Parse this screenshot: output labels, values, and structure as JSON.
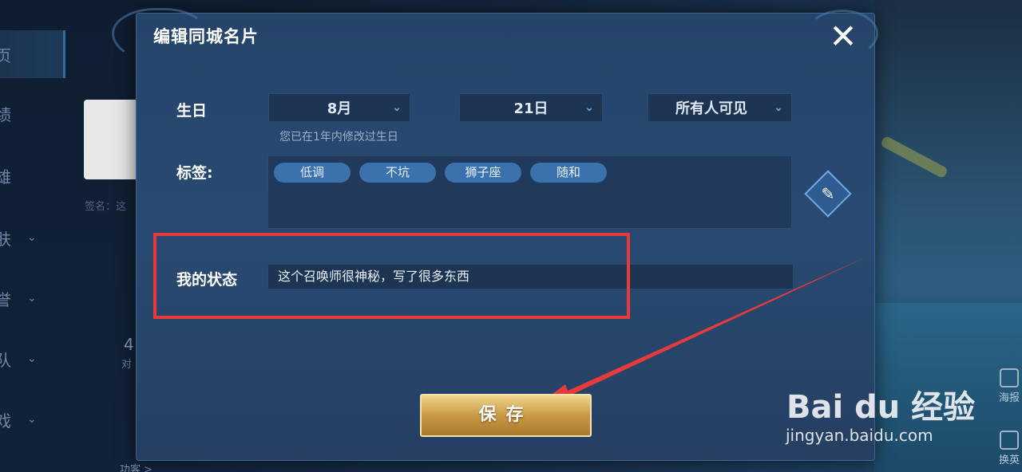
{
  "background": {
    "nav_items": [
      "页",
      "绩",
      "雄",
      "肤",
      "誉",
      "队",
      "戏"
    ],
    "sign_text": "签名：这",
    "stat_number": "4",
    "stat_label": "对",
    "bottom_text": "功客 >",
    "side_buttons": [
      "海报",
      "换英"
    ]
  },
  "dialog": {
    "title": "编辑同城名片",
    "birthday": {
      "label": "生日",
      "month": "8月",
      "day": "21日",
      "visibility": "所有人可见",
      "hint": "您已在1年内修改过生日"
    },
    "tags": {
      "label": "标签:",
      "items": [
        "低调",
        "不坑",
        "狮子座",
        "随和"
      ]
    },
    "status": {
      "label": "我的状态",
      "value": "这个召唤师很神秘，写了很多东西"
    },
    "save_label": "保存"
  },
  "annotation": {
    "highlight_color": "#e83a3a"
  },
  "watermark": {
    "logo": "Bai du 经验",
    "url": "jingyan.baidu.com"
  },
  "colors": {
    "accent": "#3b72ad",
    "gold": "#c99a45"
  }
}
